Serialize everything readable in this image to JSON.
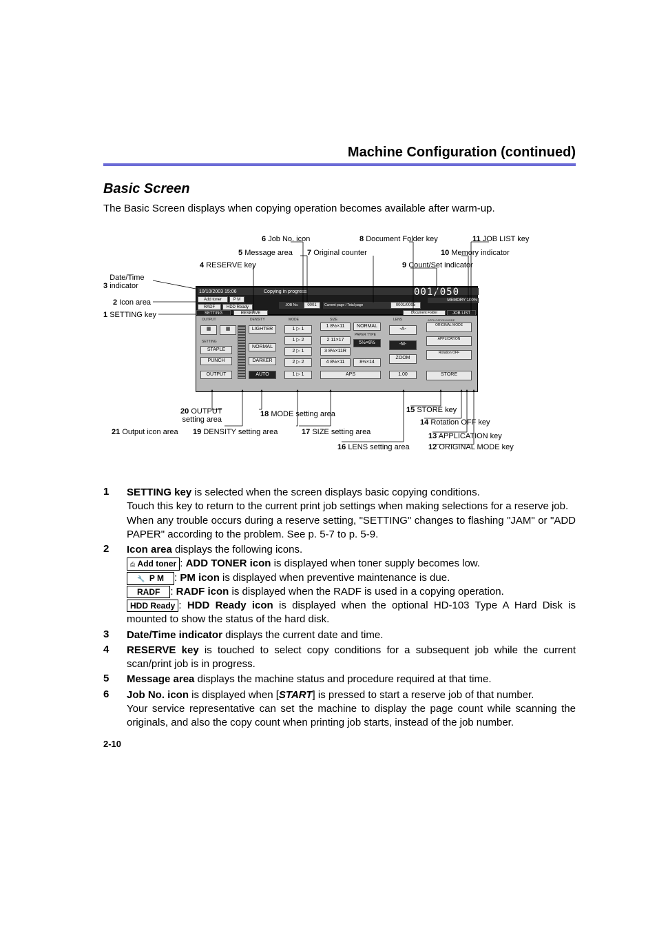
{
  "header": {
    "title": "Machine Configuration (continued)"
  },
  "section": {
    "title": "Basic Screen",
    "intro": "The Basic Screen displays when copying operation becomes available after warm-up."
  },
  "callouts": {
    "c1": {
      "num": "1",
      "label": "SETTING key"
    },
    "c2": {
      "num": "2",
      "label": "Icon area"
    },
    "c3": {
      "num": "3",
      "label": "Date/Time indicator"
    },
    "c4": {
      "num": "4",
      "label": "RESERVE key"
    },
    "c5": {
      "num": "5",
      "label": "Message area"
    },
    "c6": {
      "num": "6",
      "label": "Job No. icon"
    },
    "c7": {
      "num": "7",
      "label": "Original counter"
    },
    "c8": {
      "num": "8",
      "label": "Document Folder key"
    },
    "c9": {
      "num": "9",
      "label": "Count/Set indicator"
    },
    "c10": {
      "num": "10",
      "label": "Memory indicator"
    },
    "c11": {
      "num": "11",
      "label": "JOB LIST key"
    },
    "c12": {
      "num": "12",
      "label": "ORIGINAL MODE key"
    },
    "c13": {
      "num": "13",
      "label": "APPLICATION key"
    },
    "c14": {
      "num": "14",
      "label": "Rotation OFF key"
    },
    "c15": {
      "num": "15",
      "label": "STORE key"
    },
    "c16": {
      "num": "16",
      "label": "LENS setting area"
    },
    "c17": {
      "num": "17",
      "label": "SIZE setting area"
    },
    "c18": {
      "num": "18",
      "label": "MODE setting area"
    },
    "c19": {
      "num": "19",
      "label": "DENSITY setting area"
    },
    "c20a": {
      "num": "20",
      "label": "OUTPUT"
    },
    "c20b": {
      "label": "setting area"
    },
    "c21": {
      "num": "21",
      "label": "Output icon area"
    }
  },
  "lcd": {
    "datetime": "10/10/2003  15:06",
    "status": "Copying in progress",
    "addtoner": "Add toner",
    "pm": "P M",
    "radf": "RADF",
    "hdd": "HDD Ready",
    "jobno": "JOB No.",
    "jobno_val": "0001",
    "curpg": "Current page / Total page",
    "curpg_val": "0001/0005",
    "counter": "001/050",
    "memory": "MEMORY 100%",
    "setting": "SETTING",
    "reserve": "RESERVE",
    "docfolder": "Document Folder",
    "joblist": "JOB LIST",
    "output": "OUTPUT",
    "density": "DENSITY",
    "mode": "MODE",
    "size": "SIZE",
    "lens": "LENS",
    "appmode": "APPLICATION MODE",
    "setting_grp": "SETTING",
    "staple": "STAPLE",
    "punch": "PUNCH",
    "output_btn": "OUTPUT",
    "lighter": "LIGHTER",
    "normal": "NORMAL",
    "darker": "DARKER",
    "auto": "AUTO",
    "m1": "1 ▷ 1",
    "m2": "1 ▷ 2",
    "m3": "2 ▷ 1",
    "m4": "2 ▷ 2",
    "m5": "1 ▷ 1",
    "s_normal": "NORMAL",
    "papertype": "PAPER TYPE",
    "s1": "1 8½×11",
    "s2": "2 11×17",
    "s3": "3 8½×11R",
    "s4": "4 8½×11",
    "sbp": "5½×8½",
    "s5": "8½×14",
    "aps": "APS",
    "lens_a": "-A-",
    "lens_m": "-M-",
    "zoom": "ZOOM",
    "lens_v": "1.00",
    "origmode": "ORIGINAL MODE",
    "application": "APPLICATION",
    "rotoff": "Rotation OFF",
    "store": "STORE"
  },
  "defs": {
    "d1": {
      "num": "1",
      "lead": "SETTING key",
      "t1": " is selected when the screen displays basic copying conditions.",
      "p2": "Touch this key to return to the current print job settings when making selections for a reserve job.",
      "p3": "When any trouble occurs during a reserve setting, \"SETTING\" changes to flashing \"JAM\" or \"ADD PAPER\" according to the problem. See p. 5-7 to p. 5-9."
    },
    "d2": {
      "num": "2",
      "lead": "Icon area",
      "t1": " displays the following icons.",
      "addtoner_pill": "Add toner",
      "i1b": "ADD TONER icon",
      "i1t": " is displayed when toner supply becomes low.",
      "pm_pill": "P M",
      "i2b": "PM icon",
      "i2t": " is displayed when preventive maintenance is due.",
      "radf_pill": "RADF",
      "i3b": "RADF icon",
      "i3t": " is displayed when the RADF is used in a copying operation.",
      "hdd_pill": "HDD Ready",
      "i4b": "HDD Ready icon",
      "i4t": " is displayed when the optional HD-103 Type A Hard Disk is mounted to show the status of the hard disk."
    },
    "d3": {
      "num": "3",
      "lead": "Date/Time indicator",
      "t1": " displays the current date and time."
    },
    "d4": {
      "num": "4",
      "lead": "RESERVE key",
      "t1": " is touched to select copy conditions for a subsequent job while the current scan/print job is in progress."
    },
    "d5": {
      "num": "5",
      "lead": "Message area",
      "t1": " displays the machine status and procedure required at that time."
    },
    "d6": {
      "num": "6",
      "lead": "Job No. icon",
      "t1a": " is displayed when [",
      "start": "START",
      "t1b": "] is pressed to start a reserve job of that number.",
      "p2": "Your service representative can set the machine to display the page count while scanning the originals, and also the copy count when printing job starts, instead of the job number."
    }
  },
  "pageNumber": "2-10"
}
